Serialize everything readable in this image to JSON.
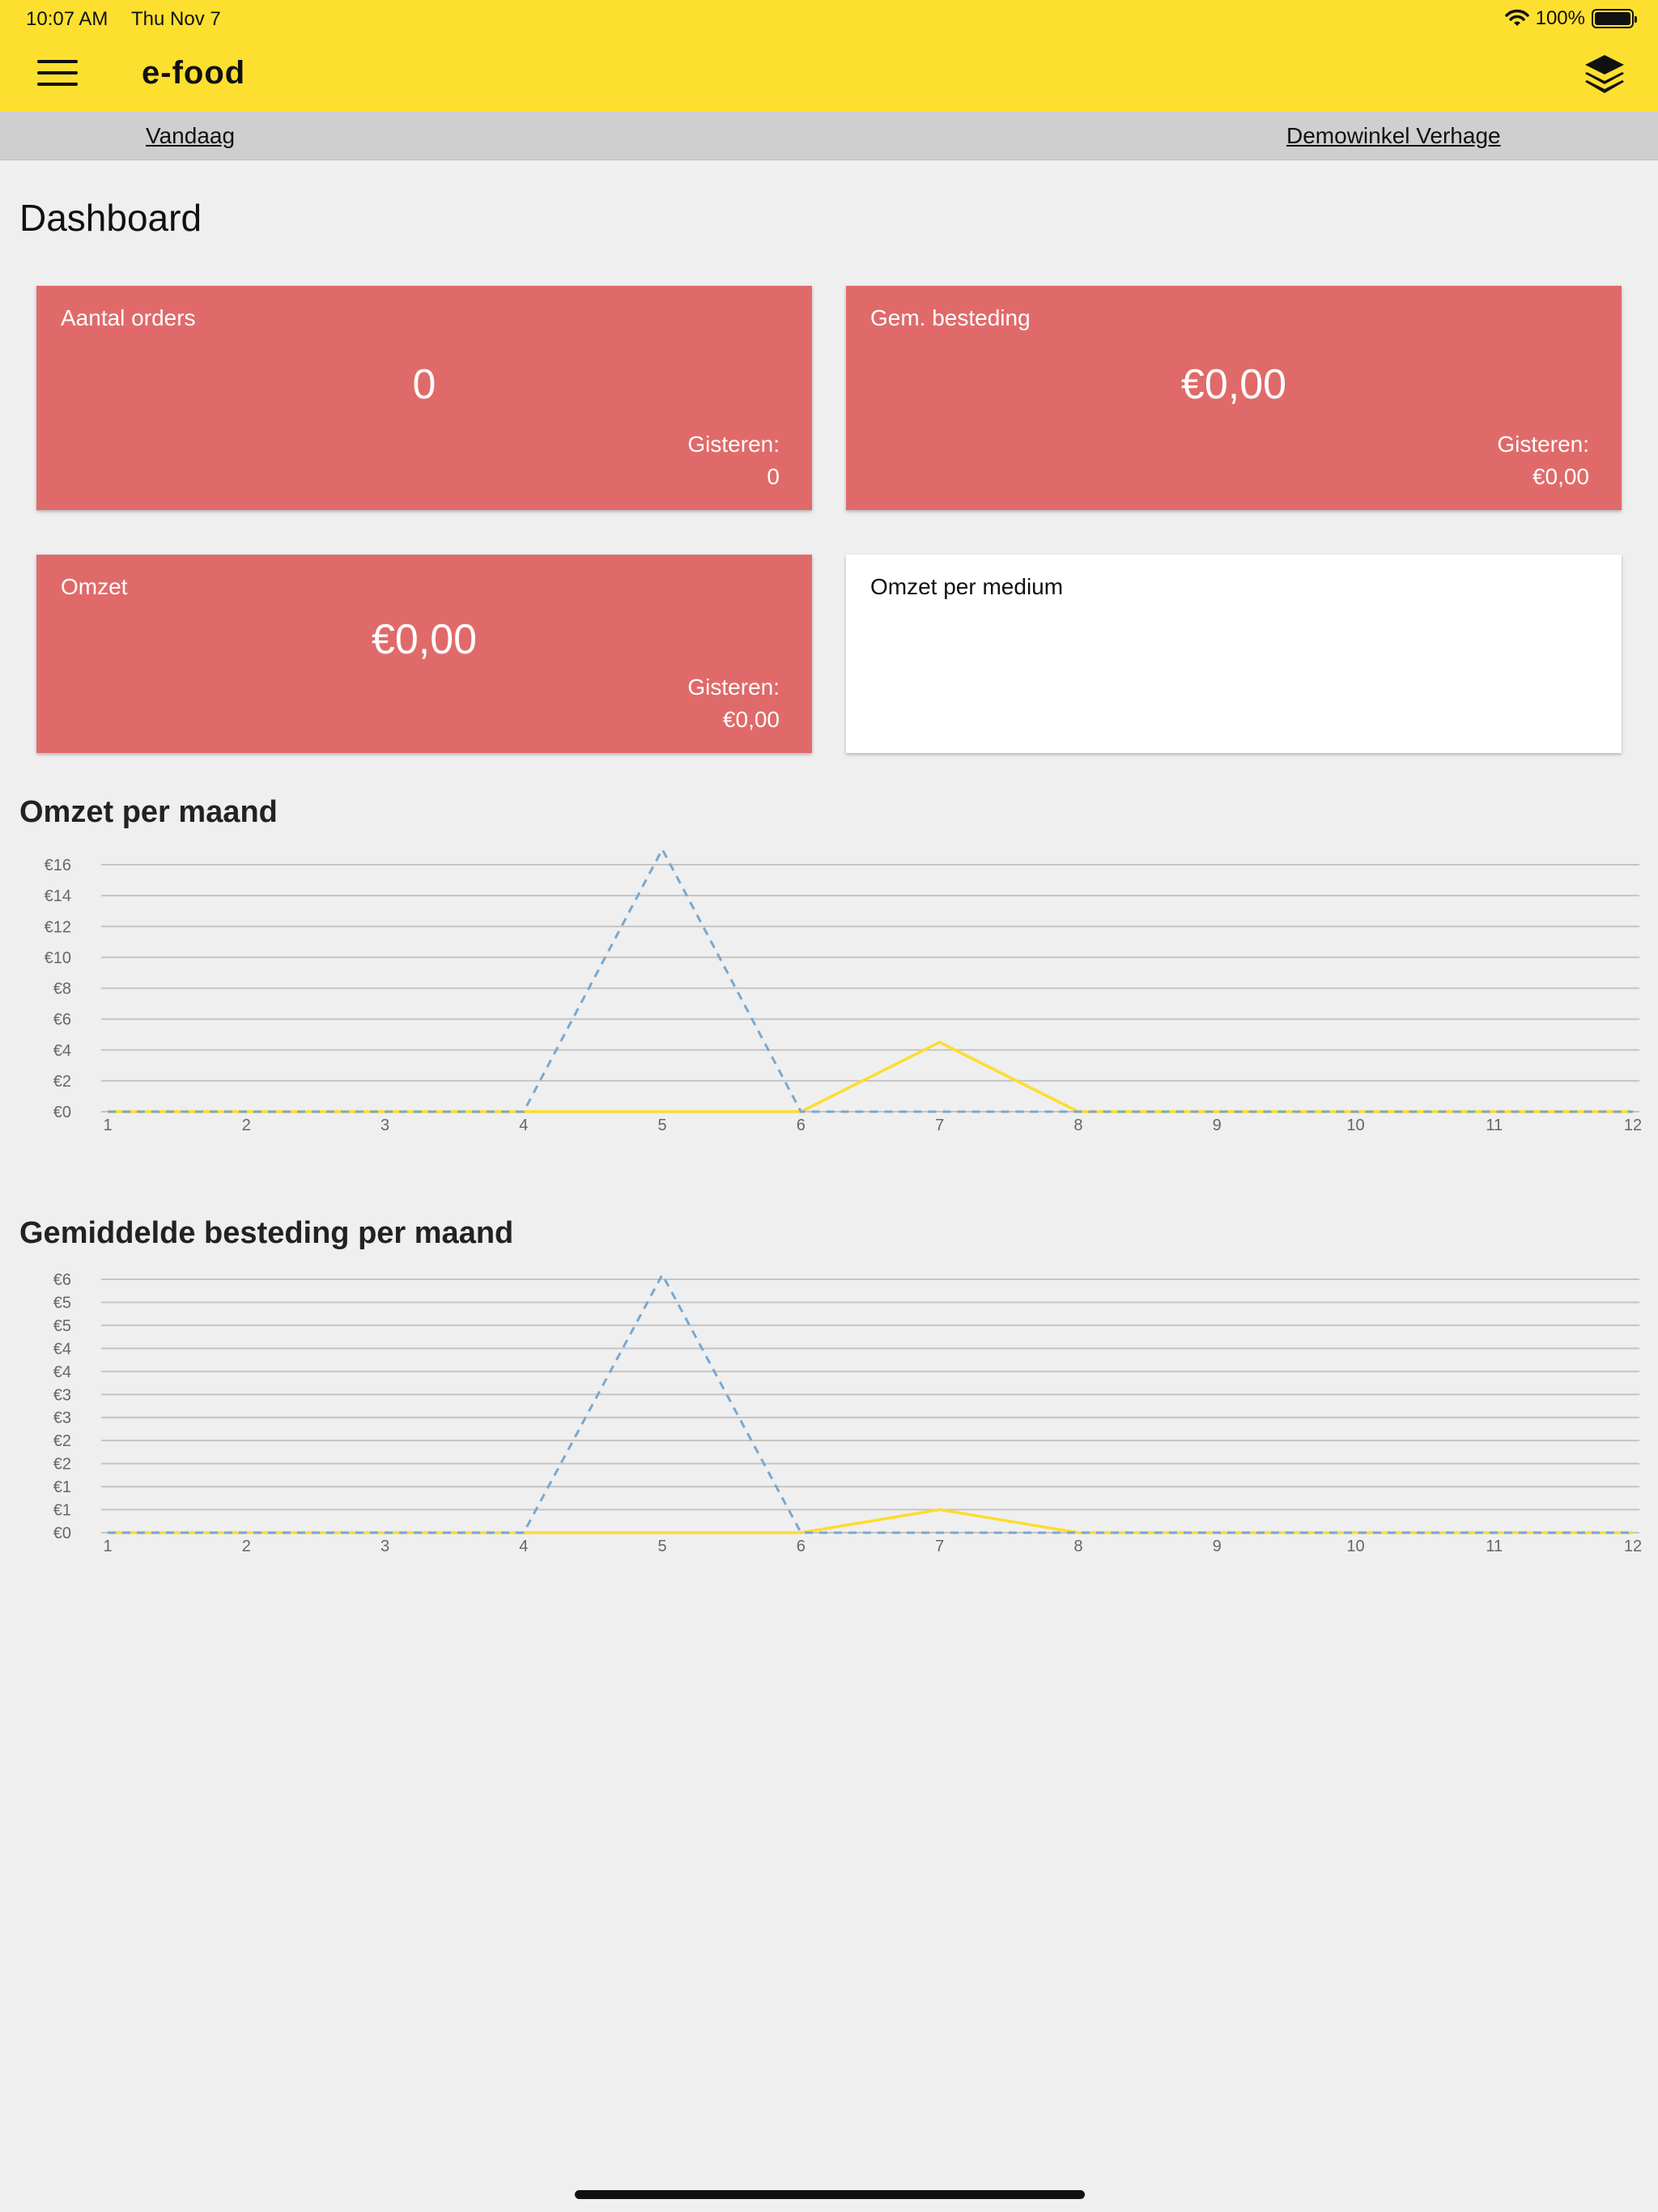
{
  "statusbar": {
    "time": "10:07 AM",
    "date": "Thu Nov 7",
    "battery": "100%"
  },
  "appbar": {
    "title": "e-food"
  },
  "subbar": {
    "left_link": "Vandaag",
    "right_link": "Demowinkel Verhage"
  },
  "page": {
    "title": "Dashboard"
  },
  "cards": {
    "orders": {
      "label": "Aantal orders",
      "value": "0",
      "yesterday_label": "Gisteren:",
      "yesterday_value": "0"
    },
    "avg_spend": {
      "label": "Gem. besteding",
      "value": "€0,00",
      "yesterday_label": "Gisteren:",
      "yesterday_value": "€0,00"
    },
    "revenue": {
      "label": "Omzet",
      "value": "€0,00",
      "yesterday_label": "Gisteren:",
      "yesterday_value": "€0,00"
    },
    "medium": {
      "label": "Omzet per medium"
    }
  },
  "sections": {
    "monthly_revenue": "Omzet per maand",
    "monthly_avg": "Gemiddelde besteding per maand"
  },
  "colors": {
    "header": "#fde02f",
    "card": "#e06a6a",
    "series_yellow": "#fddc2e",
    "series_blue": "#7aa8cf"
  },
  "chart_data": [
    {
      "type": "line",
      "title": "Omzet per maand",
      "x": [
        1,
        2,
        3,
        4,
        5,
        6,
        7,
        8,
        9,
        10,
        11,
        12
      ],
      "ylim": [
        0,
        16
      ],
      "y_ticks": [
        "€0",
        "€2",
        "€4",
        "€6",
        "€8",
        "€10",
        "€12",
        "€14",
        "€16"
      ],
      "series": [
        {
          "values": [
            0,
            0,
            0,
            0,
            17,
            0,
            0,
            0,
            0,
            0,
            0,
            0
          ],
          "color": "#7aa8cf",
          "style": "dashed"
        },
        {
          "values": [
            0,
            0,
            0,
            0,
            0,
            0,
            4.5,
            0,
            0,
            0,
            0,
            0
          ],
          "color": "#fddc2e",
          "style": "solid"
        }
      ],
      "grid": true
    },
    {
      "type": "line",
      "title": "Gemiddelde besteding per maand",
      "x": [
        1,
        2,
        3,
        4,
        5,
        6,
        7,
        8,
        9,
        10,
        11,
        12
      ],
      "ylim": [
        0,
        5.5
      ],
      "y_ticks": [
        "€0",
        "€1",
        "€1",
        "€2",
        "€2",
        "€3",
        "€3",
        "€4",
        "€4",
        "€5",
        "€5",
        "€6"
      ],
      "series": [
        {
          "values": [
            0,
            0,
            0,
            0,
            5.6,
            0,
            0,
            0,
            0,
            0,
            0,
            0
          ],
          "color": "#7aa8cf",
          "style": "dashed"
        },
        {
          "values": [
            0,
            0,
            0,
            0,
            0,
            0,
            0.5,
            0,
            0,
            0,
            0,
            0
          ],
          "color": "#fddc2e",
          "style": "solid"
        }
      ],
      "grid": true
    }
  ]
}
